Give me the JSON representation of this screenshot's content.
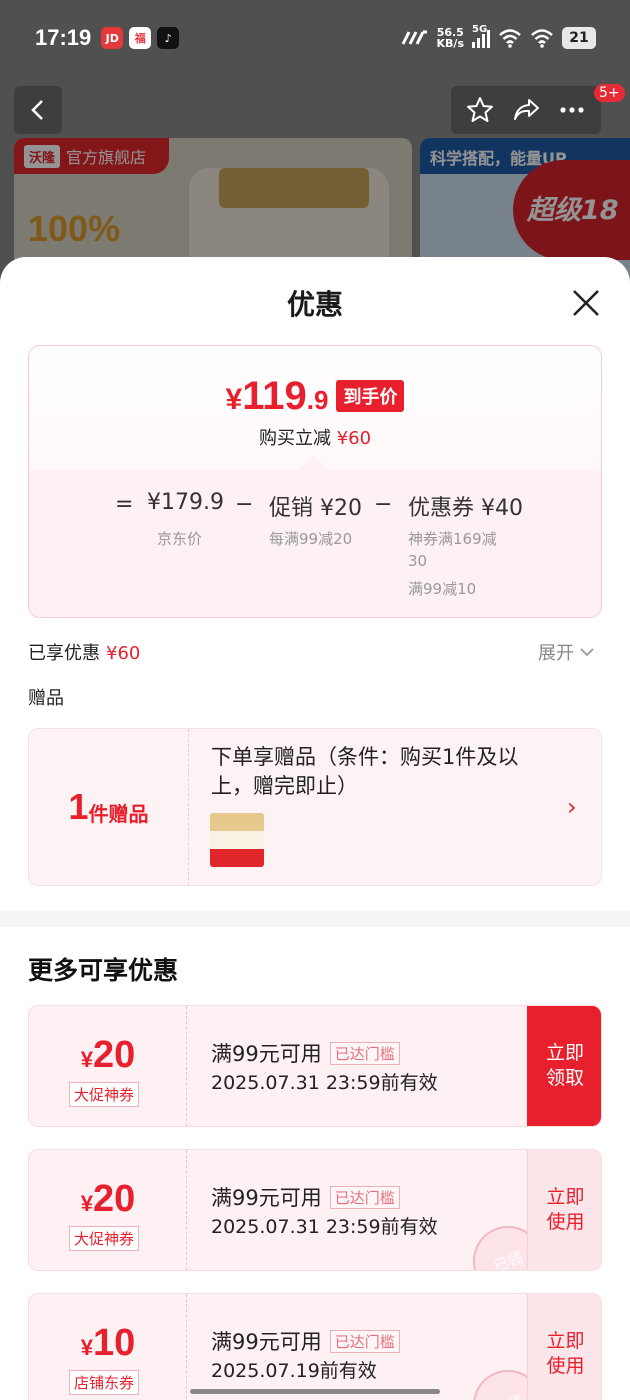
{
  "status_bar": {
    "time": "17:19",
    "apps": [
      "jd-app-icon",
      "fu-app-icon",
      "tiktok-icon"
    ],
    "speed_value": "56.5",
    "speed_unit": "KB/s",
    "network": "5G",
    "battery": "21"
  },
  "background": {
    "store_logo": "沃隆",
    "store_label": "官方旗舰店",
    "headline": "100%",
    "side_banner": "科学搭配，能量UP",
    "super_badge": "超级18",
    "notif_badge": "5+"
  },
  "sheet": {
    "title": "优惠",
    "price": {
      "yen": "¥",
      "integer": "119",
      "decimal": ".9",
      "tag": "到手价",
      "saving_label": "购买立减",
      "saving_value": "¥60"
    },
    "breakdown": {
      "eq": "=",
      "minus": "−",
      "base_value": "¥179.9",
      "base_label": "京东价",
      "promo_value": "促销 ¥20",
      "promo_label": "每满99减20",
      "coupon_value": "优惠券 ¥40",
      "coupon_label_1": "神券满169减",
      "coupon_label_2": "30",
      "coupon_label_3": "满99减10"
    },
    "enjoyed_label": "已享优惠",
    "enjoyed_value": "¥60",
    "expand_label": "展开",
    "gift_section_label": "赠品",
    "gift": {
      "count": "1",
      "unit": "件赠品",
      "description": "下单享赠品（条件：购买1件及以上，赠完即止）"
    },
    "more_title": "更多可享优惠",
    "coupons": [
      {
        "yen": "¥",
        "amount": "20",
        "type": "大促神券",
        "condition": "满99元可用",
        "status": "已达门槛",
        "expiry": "2025.07.31 23:59前有效",
        "action": "立即领取"
      },
      {
        "yen": "¥",
        "amount": "20",
        "type": "大促神券",
        "condition": "满99元可用",
        "status": "已达门槛",
        "expiry": "2025.07.31 23:59前有效",
        "action": "立即使用",
        "stamp": "已领"
      },
      {
        "yen": "¥",
        "amount": "10",
        "type": "店铺东券",
        "condition": "满99元可用",
        "status": "已达门槛",
        "expiry": "2025.07.19前有效",
        "action": "立即使用",
        "stamp": "已领"
      }
    ]
  },
  "colors": {
    "accent_red": "#e8202e",
    "card_pink": "#fdf1f3"
  }
}
